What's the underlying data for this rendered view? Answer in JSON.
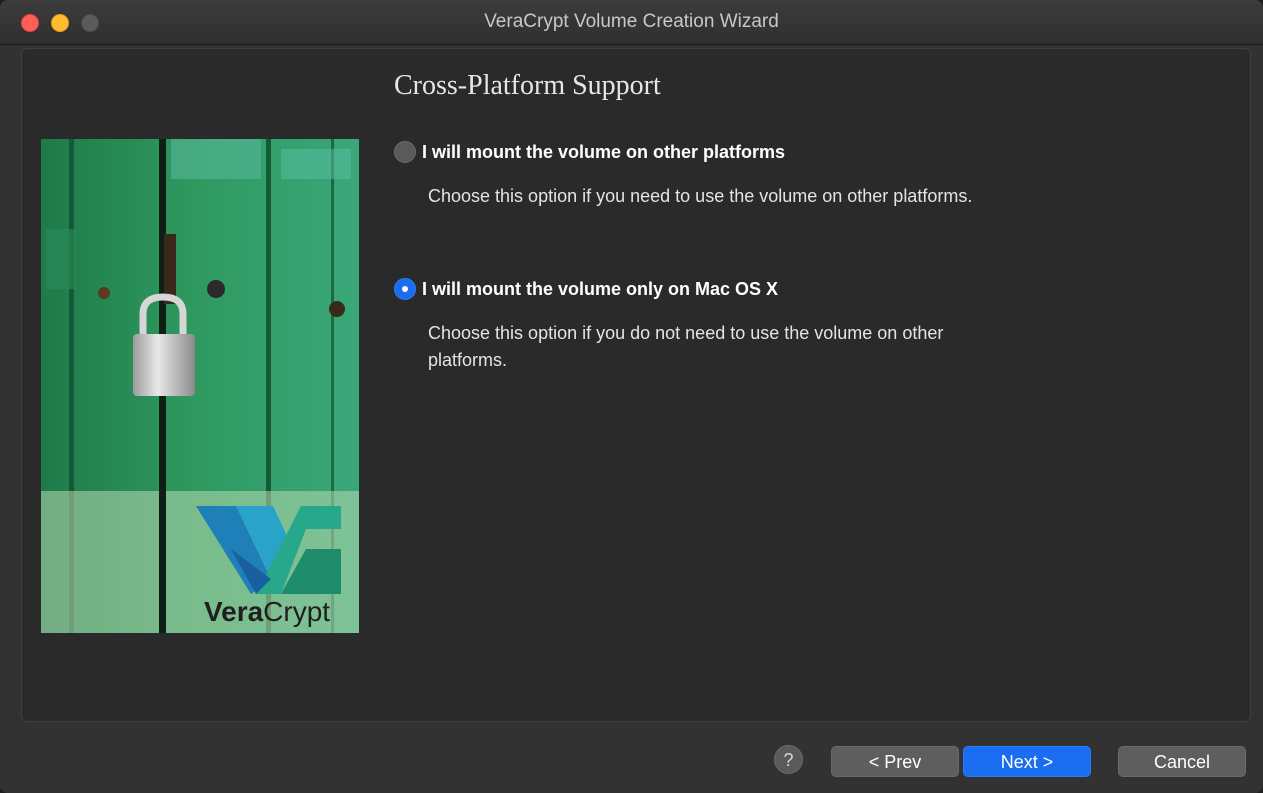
{
  "window": {
    "title": "VeraCrypt Volume Creation Wizard"
  },
  "page": {
    "heading": "Cross-Platform Support"
  },
  "options": [
    {
      "label": "I will mount the volume on other platforms",
      "description": "Choose this option if you need to use the volume on other platforms.",
      "selected": false
    },
    {
      "label": "I will mount the volume only on Mac OS X",
      "description": "Choose this option if you do not need to use the volume on other platforms.",
      "selected": true
    }
  ],
  "logo": {
    "text_bold": "Vera",
    "text_light": "Crypt"
  },
  "buttons": {
    "help": "?",
    "prev": "< Prev",
    "next": "Next >",
    "cancel": "Cancel"
  },
  "colors": {
    "accent": "#1a6cf0",
    "window_bg": "#323232",
    "close": "#fe5f57",
    "minimize": "#febc2e"
  }
}
